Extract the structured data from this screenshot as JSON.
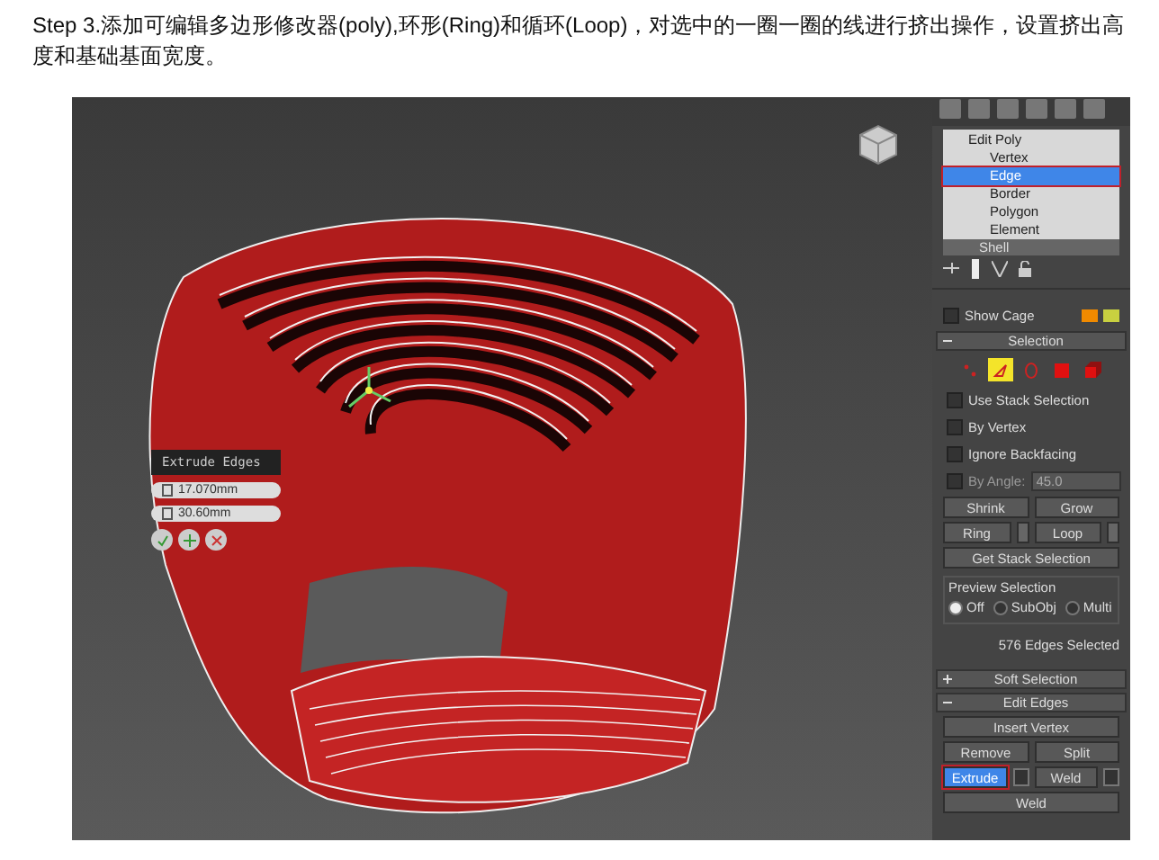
{
  "heading": "Step 3.添加可编辑多边形修改器(poly),环形(Ring)和循环(Loop)，对选中的一圈一圈的线进行挤出操作，设置挤出高度和基础基面宽度。",
  "caddy": {
    "title": "Extrude Edges",
    "fields": [
      "17.070mm",
      "30.60mm"
    ]
  },
  "stack": {
    "modifier": "Edit Poly",
    "subobjects": [
      {
        "label": "Vertex",
        "selected": false
      },
      {
        "label": "Edge",
        "selected": true
      },
      {
        "label": "Border",
        "selected": false
      },
      {
        "label": "Polygon",
        "selected": false
      },
      {
        "label": "Element",
        "selected": false
      }
    ],
    "next": "Shell"
  },
  "show_cage": {
    "label": "Show Cage",
    "checked": false
  },
  "selection": {
    "title": "Selection",
    "expanded": true,
    "modes": [
      {
        "kind": "vertex",
        "selected": false
      },
      {
        "kind": "edge",
        "selected": true
      },
      {
        "kind": "border",
        "selected": false
      },
      {
        "kind": "polygon",
        "selected": false
      },
      {
        "kind": "element",
        "selected": false
      }
    ],
    "checkboxes": [
      {
        "label": "Use Stack Selection",
        "checked": false
      },
      {
        "label": "By Vertex",
        "checked": false
      },
      {
        "label": "Ignore Backfacing",
        "checked": false
      }
    ],
    "by_angle": {
      "label": "By Angle:",
      "checked": false,
      "value": "45.0"
    },
    "buttons": [
      "Shrink",
      "Grow"
    ],
    "spinner_buttons": [
      "Ring",
      "Loop"
    ],
    "get_stack": "Get Stack Selection",
    "preview": {
      "title": "Preview Selection",
      "options": [
        {
          "label": "Off",
          "selected": true
        },
        {
          "label": "SubObj",
          "selected": false
        },
        {
          "label": "Multi",
          "selected": false
        }
      ]
    },
    "status": "576 Edges Selected"
  },
  "soft_selection": {
    "title": "Soft Selection",
    "expanded": false
  },
  "edit_edges": {
    "title": "Edit Edges",
    "expanded": true,
    "rows": [
      [
        {
          "label": "Insert Vertex",
          "selected": false,
          "settings": false
        }
      ],
      [
        {
          "label": "Remove",
          "selected": false,
          "settings": false
        },
        {
          "label": "Split",
          "selected": false,
          "settings": false
        }
      ],
      [
        {
          "label": "Extrude",
          "selected": true,
          "settings": true
        },
        {
          "label": "Weld",
          "selected": false,
          "settings": true
        }
      ],
      [
        {
          "label": "Weld",
          "selected": false,
          "settings": false
        }
      ]
    ]
  }
}
